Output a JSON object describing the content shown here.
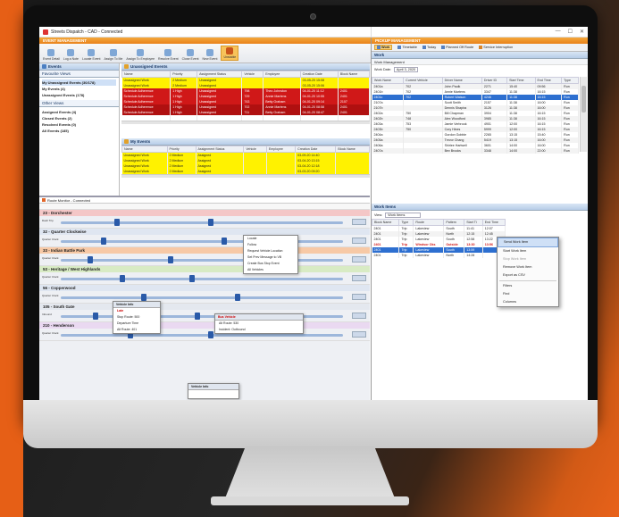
{
  "app": {
    "title": "Streets Dispatch - CAD - Connected",
    "header_band": "EVENT MANAGEMENT",
    "window_controls": [
      "—",
      "☐",
      "✕"
    ]
  },
  "toolbar": {
    "buttons": [
      "Event Detail",
      "Log a Note",
      "Locate Event",
      "Assign To Me",
      "Assign To Employee",
      "Resolve Event",
      "Close Event",
      "New Event",
      "Unstable"
    ]
  },
  "filters": {
    "header": "Events",
    "favourite_header": "Favourite Views",
    "items": [
      "My Unassigned Events (30/178)",
      "My Events (4)",
      "Unassigned Events (178)"
    ],
    "other_header": "Other Views",
    "other_items": [
      "Assigned Events (4)",
      "Closed Events (2)",
      "Resolved Events (0)",
      "All Events (185)"
    ]
  },
  "unassigned": {
    "header": "Unassigned Events",
    "columns": [
      "Name",
      "Priority",
      "Assignment Status",
      "Vehicle",
      "Employee",
      "Creation Date",
      "Block Name"
    ],
    "rows": [
      {
        "style": "yellow",
        "cells": [
          "Unassigned Work",
          "2 Medium",
          "Unassigned",
          "",
          "",
          "03-05-20 15:08",
          ""
        ]
      },
      {
        "style": "yellow",
        "cells": [
          "Unassigned Work",
          "2 Medium",
          "Unassigned",
          "",
          "",
          "03-05-20 15:06",
          ""
        ]
      },
      {
        "style": "red",
        "cells": [
          "Schedule Adherence",
          "1 High",
          "Unassigned",
          "798",
          "Theo Johnston",
          "04-01-20 11:12",
          "2401"
        ]
      },
      {
        "style": "red",
        "cells": [
          "Schedule Adherence",
          "1 High",
          "Unassigned",
          "729",
          "Annie Martens",
          "04-01-20 10:55",
          "2401"
        ]
      },
      {
        "style": "red",
        "cells": [
          "Schedule Adherence",
          "1 High",
          "Unassigned",
          "743",
          "Betty Graham",
          "04-01-20 09:14",
          "2107"
        ]
      },
      {
        "style": "darkred",
        "cells": [
          "Schedule Adherence",
          "1 High",
          "Unassigned",
          "702",
          "Annie Martens",
          "04-01-20 08:58",
          "2401"
        ]
      },
      {
        "style": "darkred",
        "cells": [
          "Schedule Adherence",
          "1 High",
          "Unassigned",
          "711",
          "Betty Graham",
          "04-01-20 08:47",
          "2401"
        ]
      },
      {
        "style": "white",
        "cells": [
          "",
          "",
          "",
          "",
          "",
          "",
          ""
        ]
      }
    ]
  },
  "my_events": {
    "header": "My Events",
    "columns": [
      "Name",
      "Priority",
      "Assignment Status",
      "Vehicle",
      "Employee",
      "Creation Date",
      "Block Name"
    ],
    "rows": [
      {
        "style": "yellow",
        "cells": [
          "Unassigned Work",
          "2 Medium",
          "Assigned",
          "",
          "",
          "03-09-20 14:40",
          ""
        ]
      },
      {
        "style": "yellow",
        "cells": [
          "Unassigned Work",
          "2 Medium",
          "Assigned",
          "",
          "",
          "03-04-20 13:15",
          ""
        ]
      },
      {
        "style": "yellow",
        "cells": [
          "Unassigned Work",
          "2 Medium",
          "Assigned",
          "",
          "",
          "03-04-20 12:18",
          ""
        ]
      },
      {
        "style": "yellow",
        "cells": [
          "Unassigned Work",
          "2 Medium",
          "Assigned",
          "",
          "",
          "03-03-20 09:20",
          ""
        ]
      }
    ]
  },
  "board": {
    "title": "Route Monitor - Connected",
    "lanes": [
      {
        "name": "23 - Dorchester",
        "label": "Dash Trip",
        "color": "#f4c7c7"
      },
      {
        "name": "32 - Quarter Clockwise",
        "label": "Quarter Clock",
        "color": "#dfe6f1"
      },
      {
        "name": "33 - Indian Battle Park",
        "label": "Quarter Clock",
        "color": "#f7c9a6"
      },
      {
        "name": "53 - Heritage / West Highlands",
        "label": "Quarter Clock",
        "color": "#d8ebc4"
      },
      {
        "name": "56 - Copperwood",
        "label": "Quarter Clock",
        "color": "#dfe6f1"
      },
      {
        "name": "105 - South Gate",
        "label": "Inbound",
        "color": "#e4e8ef"
      },
      {
        "name": "210 - Henderson",
        "label": "Quarter Clock",
        "color": "#ead9f1"
      }
    ],
    "popup_menu": [
      "Locate",
      "Follow",
      "Request Vehicle Location",
      "Set Prev Message to VB",
      "Create Bus Stop Event",
      "All Vehicles"
    ],
    "popup_vehicle": {
      "title": "Vehicle Info",
      "lines": [
        "Late",
        "Stop Route: 500",
        "Departure Time",
        "Alt Route: 401"
      ]
    },
    "popup_event": {
      "title": "Bus Vehicle",
      "lines": [
        "Alt Route: 530",
        "Incident: Outbound"
      ]
    },
    "popup_bottom": {
      "title": "Vehicle Info"
    }
  },
  "work": {
    "band": "PICKUP MANAGEMENT",
    "toolbar": [
      "Work",
      "Timetable",
      "Today",
      "Planned Off Route",
      "Service Interruption"
    ],
    "header": "Work",
    "sub": "Work Management",
    "filter_label": "Work Date:",
    "filter_value": "April  3, 2020",
    "columns": [
      "Work Name",
      "Current Vehicle",
      "Driver Name",
      "Driver ID",
      "Start Time",
      "End Time",
      "Type"
    ],
    "rows": [
      {
        "style": "grey",
        "cells": [
          "2401a",
          "702",
          "John Paulk",
          "2271",
          "15:40",
          "09:56",
          "Run"
        ]
      },
      {
        "style": "white",
        "cells": [
          "2401b",
          "702",
          "Annie Martens",
          "3347",
          "11:38",
          "16:15",
          "Run"
        ]
      },
      {
        "style": "sel",
        "cells": [
          "2401c",
          "702",
          "Robert Watson",
          "4246",
          "11:38",
          "16:15",
          "Run"
        ]
      },
      {
        "style": "white",
        "cells": [
          "2107a",
          "",
          "Scott Smith",
          "2157",
          "11:38",
          "16:00",
          "Run"
        ]
      },
      {
        "style": "grey",
        "cells": [
          "2107b",
          "",
          "Dennis Shapira",
          "3126",
          "11:38",
          "16:00",
          "Run"
        ]
      },
      {
        "style": "white",
        "cells": [
          "2402a",
          "750",
          "Bill Chapman",
          "3904",
          "11:38",
          "16:15",
          "Run"
        ]
      },
      {
        "style": "grey",
        "cells": [
          "2402b",
          "748",
          "Alex Woodford",
          "3985",
          "11:38",
          "16:15",
          "Run"
        ]
      },
      {
        "style": "white",
        "cells": [
          "2403a",
          "753",
          "Jamie Verbrook",
          "4901",
          "12:00",
          "16:15",
          "Run"
        ]
      },
      {
        "style": "grey",
        "cells": [
          "2403b",
          "750",
          "Cory Hines",
          "5999",
          "12:00",
          "16:15",
          "Run"
        ]
      },
      {
        "style": "white",
        "cells": [
          "2404a",
          "",
          "Gordon Gobble",
          "2265",
          "13:15",
          "15:40",
          "Run"
        ]
      },
      {
        "style": "grey",
        "cells": [
          "2405a",
          "",
          "Trevor Chang",
          "5419",
          "13:15",
          "16:00",
          "Run"
        ]
      },
      {
        "style": "white",
        "cells": [
          "2406a",
          "",
          "Shirlee Hartwell",
          "3601",
          "14:00",
          "16:00",
          "Run"
        ]
      },
      {
        "style": "grey",
        "cells": [
          "2407a",
          "",
          "Bev Brooks",
          "3348",
          "14:00",
          "22:00",
          "Run"
        ]
      }
    ]
  },
  "work_items": {
    "header": "Work Items",
    "view_label": "View:",
    "view_value": "Work Items",
    "columns": [
      "Block Name",
      "Type",
      "Route",
      "Pattern",
      "Start Ti",
      "End Time"
    ],
    "rows": [
      {
        "style": "white",
        "cells": [
          "2401",
          "Trip",
          "Lakeview",
          "South",
          "11:41",
          "12:07"
        ]
      },
      {
        "style": "grey",
        "cells": [
          "2401",
          "Trip",
          "Lakeview",
          "North",
          "12:15",
          "12:45"
        ]
      },
      {
        "style": "white",
        "cells": [
          "2401",
          "Trip",
          "Lakeview",
          "South",
          "12:58",
          "13:22"
        ]
      },
      {
        "style": "redtext",
        "cells": [
          "2401",
          "Trip",
          "Windsor Oks",
          "Outside",
          "13:30",
          "13:56"
        ]
      },
      {
        "style": "sel",
        "cells": [
          "2401",
          "Trip",
          "Lakeview",
          "South",
          "13:59",
          ""
        ]
      },
      {
        "style": "white",
        "cells": [
          "2401",
          "Trip",
          "Lakeview",
          "North",
          "14:28",
          ""
        ]
      }
    ]
  },
  "context_menu": [
    "Send Work Item",
    "Start Work Item",
    "Stop Work Item",
    "Remove Work Item",
    "Export as CSV",
    "Filters",
    "Find",
    "Columns"
  ]
}
